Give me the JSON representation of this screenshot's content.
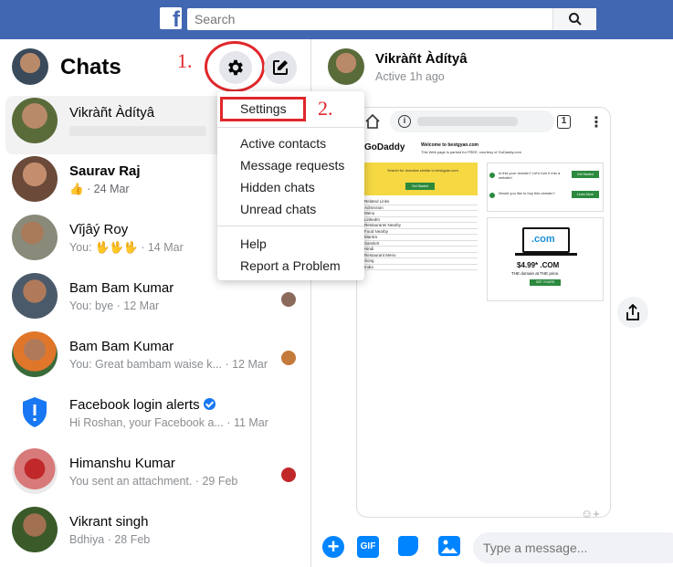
{
  "topbar": {
    "logo": "f",
    "search_placeholder": "Search"
  },
  "sidebar": {
    "title": "Chats",
    "annotation_1": "1.",
    "chats": [
      {
        "name": "Vikràñt Àdítyâ",
        "sub": "",
        "bold": false,
        "active": true
      },
      {
        "name": "Saurav Raj",
        "sub": " · 24 Mar",
        "bold": true,
        "active": false
      },
      {
        "name": "Vĩjâý Roy",
        "sub": "You: 🖖🖖🖖 · 14 Mar",
        "bold": false,
        "active": false
      },
      {
        "name": "Bam Bam Kumar",
        "sub": "You: bye · 12 Mar",
        "bold": false,
        "active": false
      },
      {
        "name": "Bam Bam Kumar",
        "sub": "You: Great bambam waise k... · 12 Mar",
        "bold": false,
        "active": false
      },
      {
        "name": "Facebook login alerts",
        "sub": "Hi Roshan, your Facebook a... · 11 Mar",
        "bold": false,
        "active": false
      },
      {
        "name": "Himanshu Kumar",
        "sub": "You sent an attachment. · 29 Feb",
        "bold": false,
        "active": false
      },
      {
        "name": "Vikrant singh",
        "sub": "Bdhiya · 28 Feb",
        "bold": false,
        "active": false
      }
    ]
  },
  "menu": {
    "annotation_2": "2.",
    "items": [
      "Settings",
      "Active contacts",
      "Message requests",
      "Hidden chats",
      "Unread chats",
      "Help",
      "Report a Problem"
    ]
  },
  "conversation": {
    "name": "Vikràñt Àdítyâ",
    "status": "Active 1h ago",
    "composer_placeholder": "Type a message...",
    "gif_label": "GIF"
  },
  "phone": {
    "tabs_count": "1",
    "site": {
      "logo": "GoDaddy",
      "welcome": "Welcome to bestgyan.com",
      "parked": "This Web page is parked for FREE, courtesy of GoDaddy.com",
      "search_text": "Search for domains similar to bestgyan.com",
      "get_started": "Get Started",
      "related_links": [
        "Related Links",
        "Admission",
        "Menu",
        "LinkedIn",
        "Restaurants Nearby",
        "Food Nearby",
        "Mantra",
        "Sanskrit",
        "Hindi",
        "Restaurant Menu",
        "Song",
        "India"
      ],
      "q1": "Is this your domain? Let's turn it into a website!",
      "q1_btn": "Get Started",
      "q2": "Would you like to buy this domain?",
      "q2_btn": "Learn More",
      "com": ".com",
      "price": "$4.99* .COM",
      "price_sub": "THE domain at THE price.",
      "get_yours": "GET YOURS"
    }
  },
  "colors": {
    "brand": "#4267b2",
    "annotation_red": "#e0262a",
    "messenger_blue": "#0084ff"
  }
}
